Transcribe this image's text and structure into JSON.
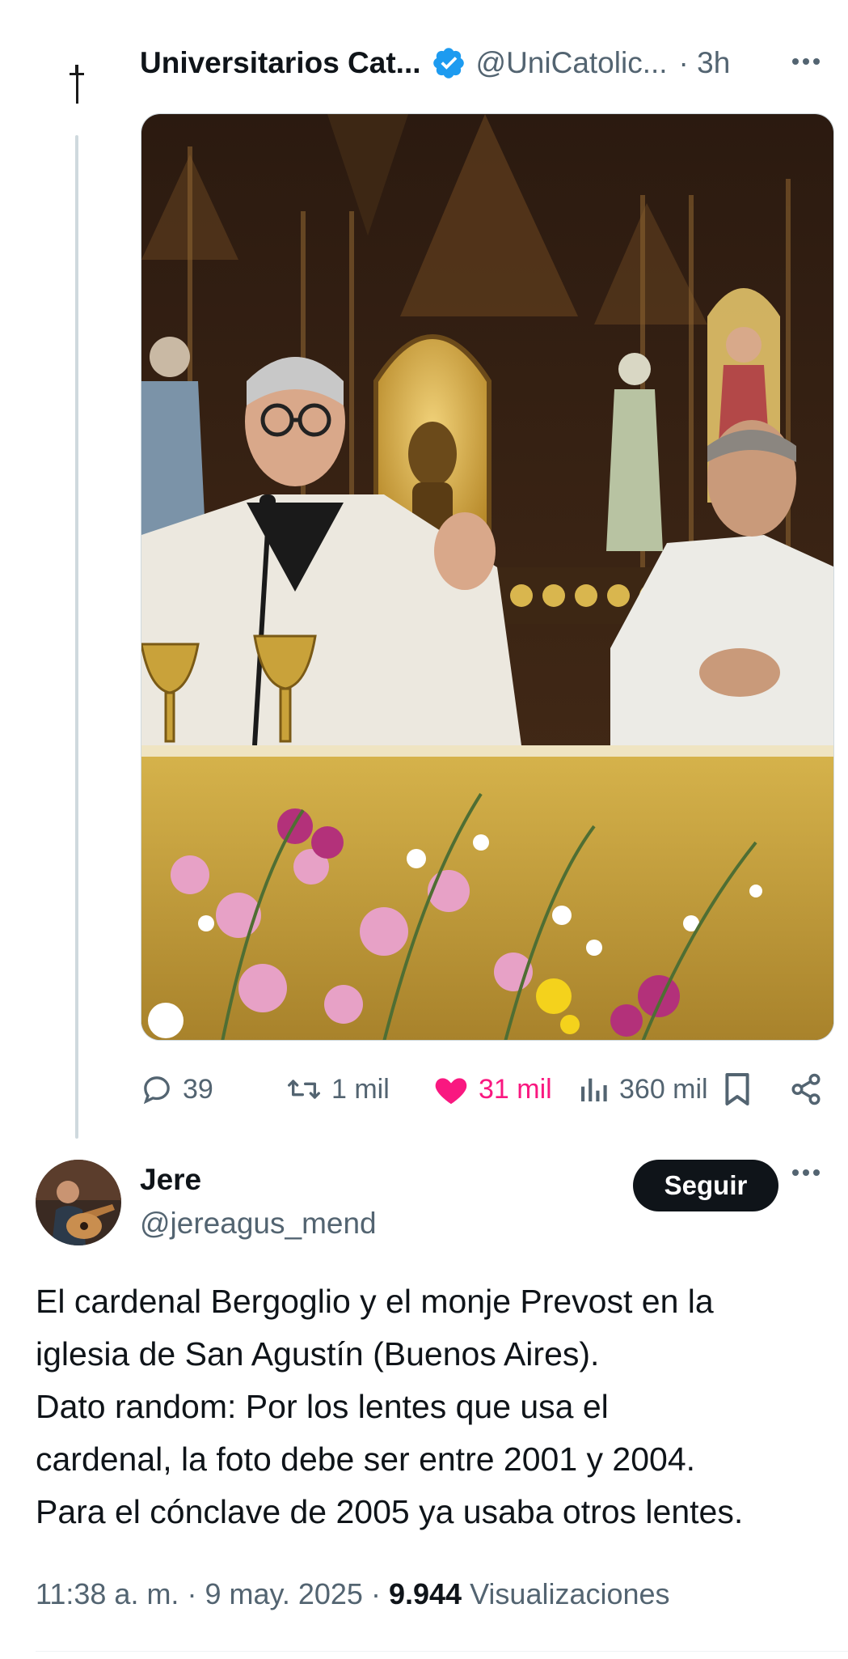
{
  "parent_post": {
    "author_name": "Universitarios Cat...",
    "verified": true,
    "handle": "@UniCatolic...",
    "time": "· 3h",
    "avatar_icon": "cross-icon",
    "image_description_colors": {
      "gold": "#c9a23a",
      "wood": "#3a2616",
      "vestment": "#ece8df"
    },
    "actions": {
      "replies": "39",
      "reposts": "1 mil",
      "likes": "31 mil",
      "views": "360 mil"
    },
    "like_color": "#f91880"
  },
  "reply": {
    "author_name": "Jere",
    "handle": "@jereagus_mend",
    "follow_label": "Seguir",
    "text_lines": [
      "El cardenal Bergoglio y el monje Prevost en la",
      "iglesia de San Agustín (Buenos Aires).",
      "Dato random: Por los lentes que usa el",
      "cardenal, la foto debe ser entre 2001 y 2004.",
      "Para el cónclave de 2005 ya usaba otros lentes."
    ],
    "time": "11:38 a. m.",
    "separator": "·",
    "date": "9 may. 2025",
    "views_count": "9.944",
    "views_label": "Visualizaciones"
  },
  "colors": {
    "text_primary": "#0f1419",
    "text_secondary": "#536471",
    "verified_blue": "#1d9bf0",
    "thread_line": "#cfd9de"
  }
}
